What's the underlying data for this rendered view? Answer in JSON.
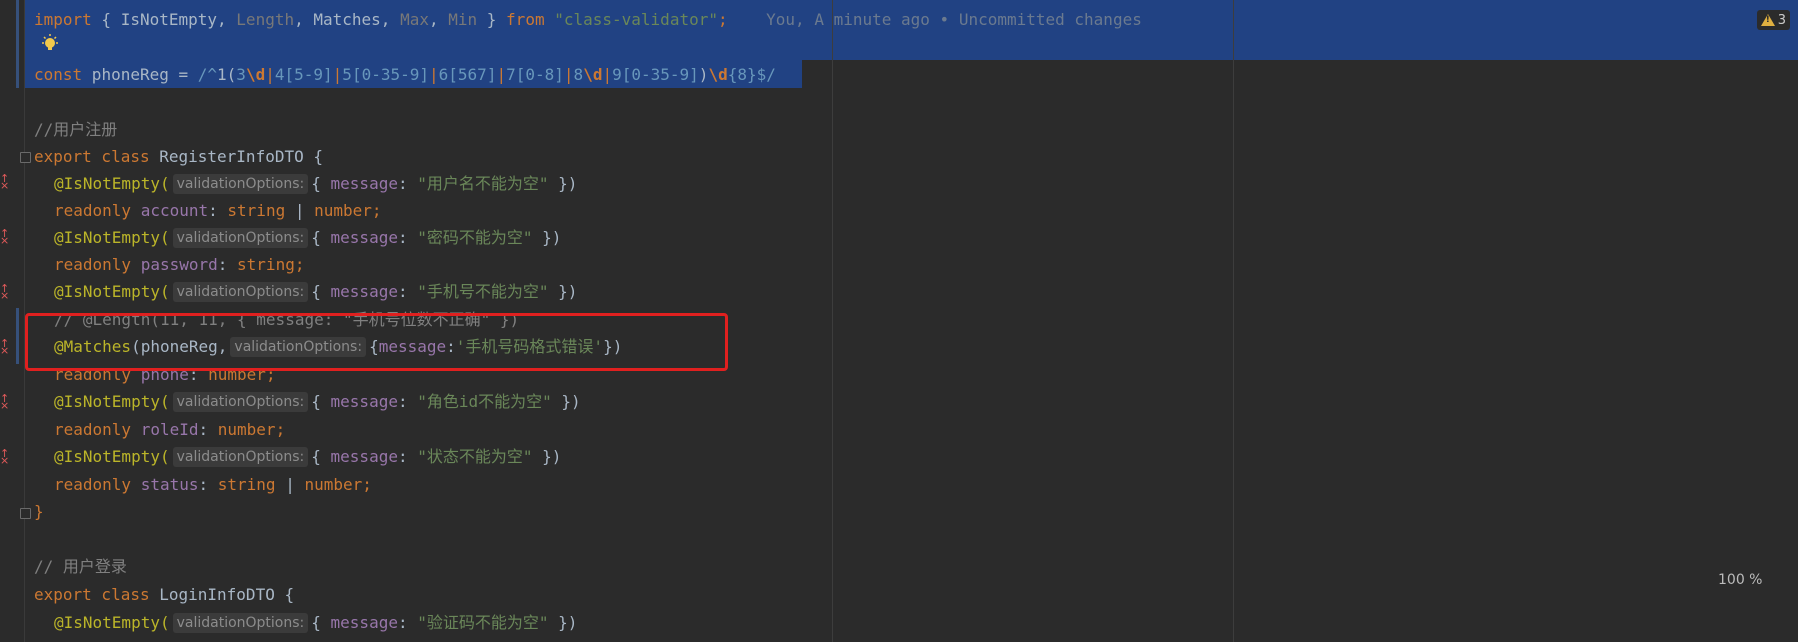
{
  "warnings": {
    "count": "3"
  },
  "zoom": "100 %",
  "blame": "You, A minute ago • Uncommitted changes",
  "code": {
    "l1": {
      "import": "import",
      "open": " { ",
      "a": "IsNotEmpty",
      "c1": ", ",
      "b": "Length",
      "c2": ", ",
      "c": "Matches",
      "c3": ", ",
      "d": "Max",
      "c4": ", ",
      "e": "Min",
      "close": " } ",
      "from": "from",
      "src": "\"class-validator\"",
      "semi": ";"
    },
    "l3": {
      "const": "const",
      "name": " phoneReg = ",
      "r1": "/^",
      "r2": "1(",
      "r3": "3",
      "r4": "\\d",
      "r5": "|",
      "r6": "4",
      "r7": "[5-9]",
      "r8": "|",
      "r9": "5",
      "r10": "[0-35-9]",
      "r11": "|",
      "r12": "6",
      "r13": "[567]",
      "r14": "|",
      "r15": "7",
      "r16": "[0-8]",
      "r17": "|",
      "r18": "8",
      "r19": "\\d",
      "r20": "|",
      "r21": "9",
      "r22": "[0-35-9]",
      "r23": ")",
      "r24": "\\d",
      "r25": "{8}",
      "r26": "$/"
    },
    "l5": "//用户注册",
    "l6": {
      "export": "export",
      "class": " class ",
      "name": "RegisterInfoDTO",
      "brace": " {"
    },
    "dec_isnotempty": "@IsNotEmpty(",
    "hint": "validationOptions:",
    "msg_key": "message",
    "colon": ": ",
    "obj_open": "{ ",
    "obj_close": " })",
    "readonly": "readonly",
    "l7": {
      "msg": "\"用户名不能为空\""
    },
    "l8": {
      "field": "account",
      "c": ": ",
      "t1": "string",
      "p": " | ",
      "t2": "number",
      "semi": ";"
    },
    "l9": {
      "msg": "\"密码不能为空\""
    },
    "l10": {
      "field": "password",
      "c": ": ",
      "t1": "string",
      "semi": ";"
    },
    "l11": {
      "msg": "\"手机号不能为空\""
    },
    "l12": "// @Length(11, 11, { message: \"手机号位数不正确\" })",
    "l13": {
      "dec": "@Matches",
      "open": "(",
      "arg": "phoneReg,",
      "obj": "{",
      "key": "message",
      "col": ":",
      "msg": "'手机号码格式错误'",
      "close": "})"
    },
    "l14": {
      "field": "phone",
      "c": ": ",
      "t1": "number",
      "semi": ";"
    },
    "l15": {
      "msg": "\"角色id不能为空\""
    },
    "l16": {
      "field": "roleId",
      "c": ": ",
      "t1": "number",
      "semi": ";"
    },
    "l17": {
      "msg": "\"状态不能为空\""
    },
    "l18": {
      "field": "status",
      "c": ": ",
      "t1": "string",
      "p": " | ",
      "t2": "number",
      "semi": ";"
    },
    "l19": "}",
    "l21": "// 用户登录",
    "l22": {
      "export": "export",
      "class": " class ",
      "name": "LoginInfoDTO",
      "brace": " {"
    },
    "l23": {
      "msg": "\"验证码不能为空\""
    }
  }
}
